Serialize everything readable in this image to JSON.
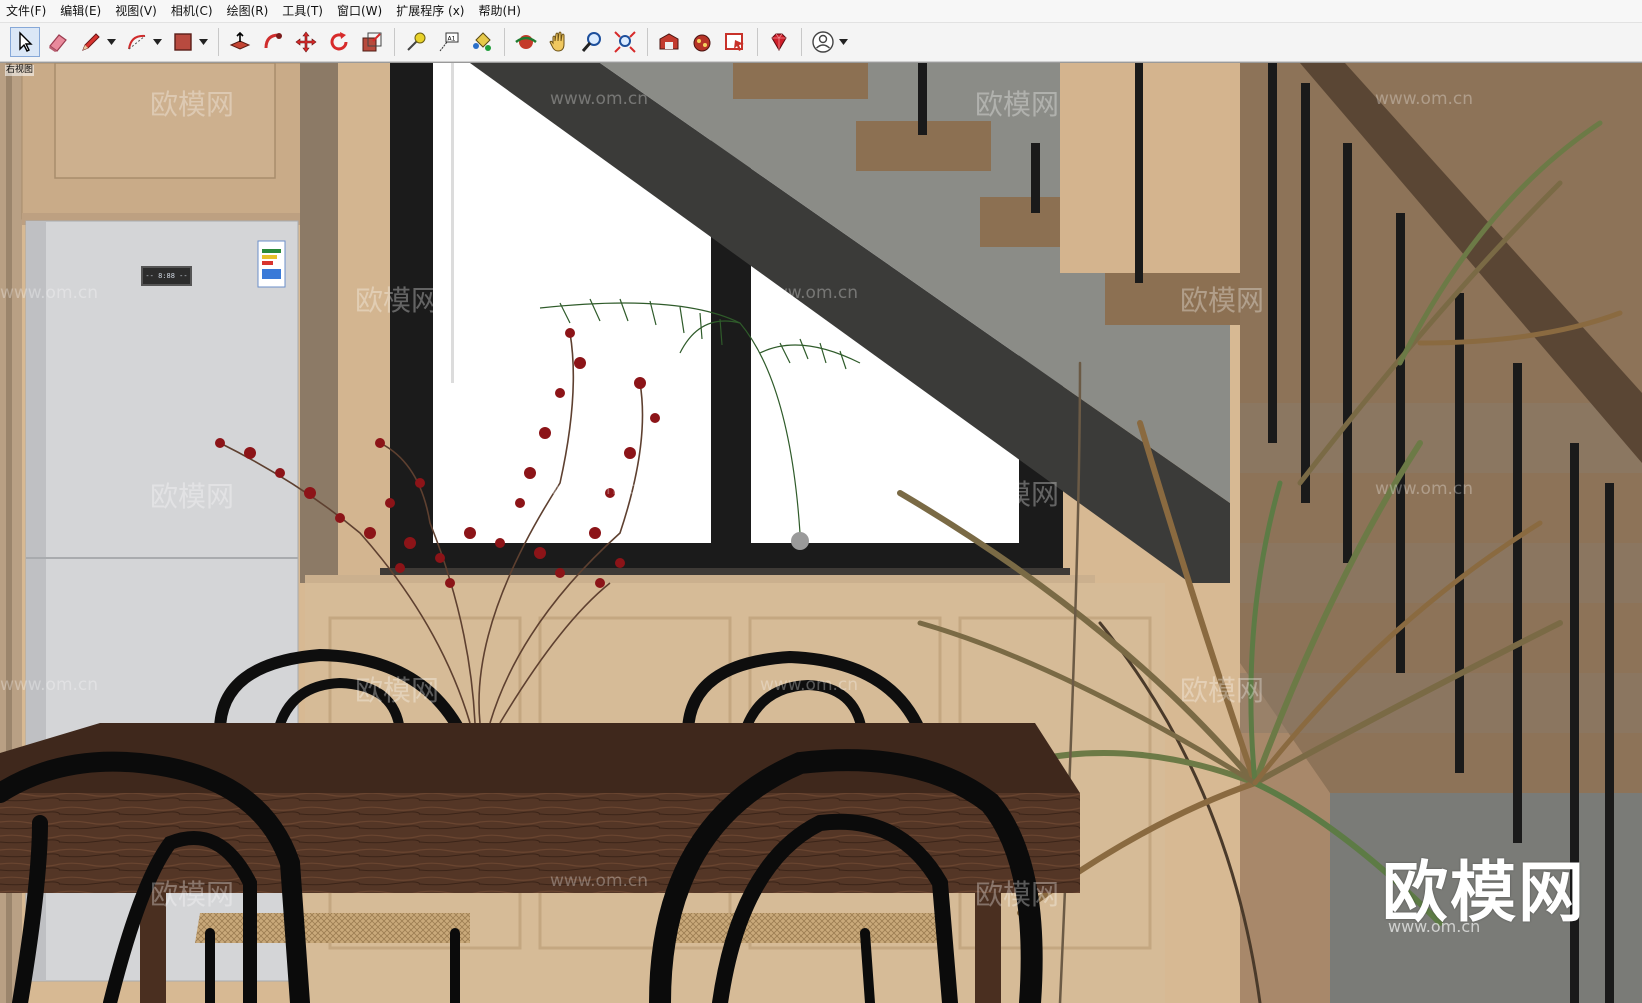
{
  "menu": [
    "文件(F)",
    "编辑(E)",
    "视图(V)",
    "相机(C)",
    "绘图(R)",
    "工具(T)",
    "窗口(W)",
    "扩展程序 (x)",
    "帮助(H)"
  ],
  "toolbar": {
    "groups": [
      [
        "select-tool",
        "eraser-tool",
        "pencil-tool",
        "arc-tool",
        "rectangle-tool"
      ],
      [
        "push-pull-tool",
        "follow-me-tool",
        "move-tool",
        "rotate-tool",
        "scale-tool"
      ],
      [
        "tape-measure-tool",
        "text-tool",
        "paint-bucket-tool"
      ],
      [
        "orbit-tool",
        "pan-tool",
        "zoom-tool",
        "zoom-extents-tool"
      ],
      [
        "warehouse-icon",
        "extension-warehouse-icon",
        "layout-icon"
      ],
      [
        "ruby-console-icon"
      ],
      [
        "account-icon"
      ]
    ]
  },
  "viewport": {
    "scene_label": "右视图",
    "fridge_display": "-- 8:88 --",
    "watermark": "欧模网",
    "watermark_url": "www.om.cn",
    "logo": "欧模网",
    "logo_url": "www.om.cn"
  },
  "colors": {
    "wall": "#d6b896",
    "stair_gray": "#8a8b86",
    "stair_tread": "#8c7052",
    "window_frame": "#1c1c1c",
    "table": "#4d3224",
    "chair": "#0e0e0e",
    "fridge": "#d3d4d6",
    "cabinet": "#cbb08c"
  }
}
